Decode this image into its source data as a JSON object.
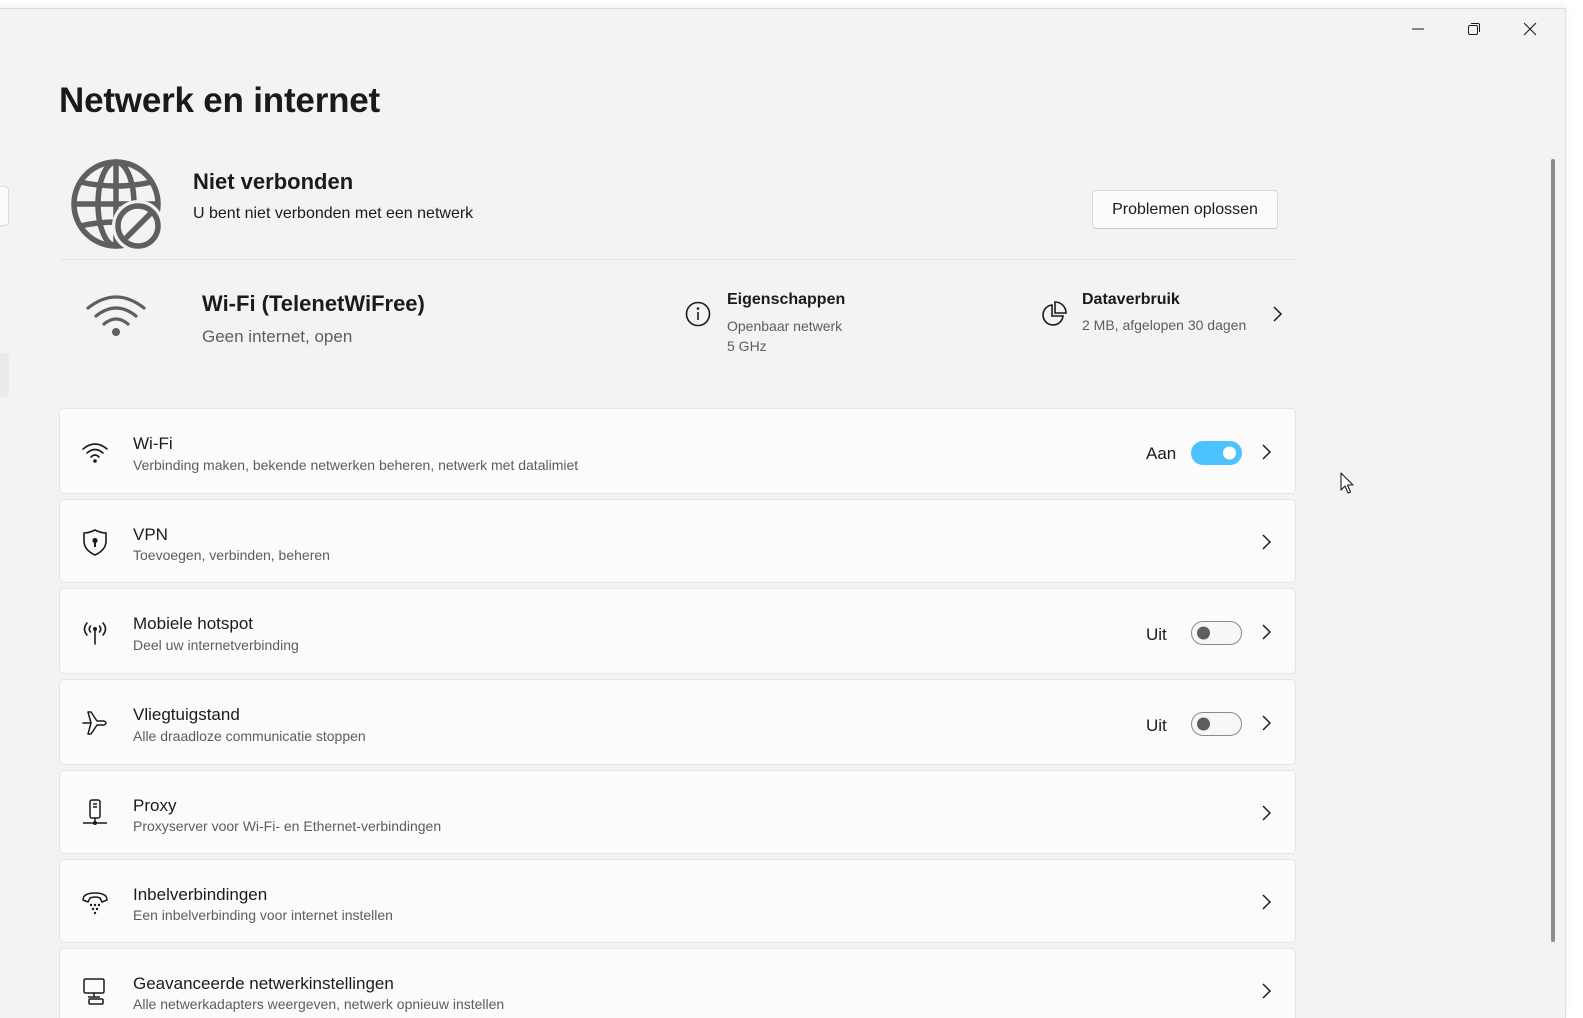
{
  "window": {
    "controls": [
      "minimize-icon",
      "restore-icon",
      "close-icon"
    ]
  },
  "page": {
    "title": "Netwerk en internet"
  },
  "status": {
    "icon": "globe-blocked-icon",
    "title": "Niet verbonden",
    "subtitle": "U bent niet verbonden met een netwerk",
    "troubleshoot_label": "Problemen oplossen"
  },
  "network": {
    "icon": "wifi-icon",
    "name": "Wi-Fi (TelenetWiFree)",
    "status": "Geen internet, open",
    "properties": {
      "icon": "info-icon",
      "title": "Eigenschappen",
      "line1": "Openbaar netwerk",
      "line2": "5 GHz"
    },
    "data_usage": {
      "icon": "pie-chart-icon",
      "title": "Dataverbruik",
      "subtitle": "2 MB, afgelopen 30 dagen"
    }
  },
  "settings": [
    {
      "key": "wifi",
      "icon": "wifi-icon",
      "title": "Wi-Fi",
      "subtitle": "Verbinding maken, bekende netwerken beheren, netwerk met datalimiet",
      "state": "Aan",
      "toggle": true
    },
    {
      "key": "vpn",
      "icon": "shield-icon",
      "title": "VPN",
      "subtitle": "Toevoegen, verbinden, beheren"
    },
    {
      "key": "hotspot",
      "icon": "hotspot-icon",
      "title": "Mobiele hotspot",
      "subtitle": "Deel uw internetverbinding",
      "state": "Uit",
      "toggle": false
    },
    {
      "key": "airplane",
      "icon": "airplane-icon",
      "title": "Vliegtuigstand",
      "subtitle": "Alle draadloze communicatie stoppen",
      "state": "Uit",
      "toggle": false
    },
    {
      "key": "proxy",
      "icon": "proxy-icon",
      "title": "Proxy",
      "subtitle": "Proxyserver voor Wi-Fi- en Ethernet-verbindingen"
    },
    {
      "key": "dialup",
      "icon": "dialup-icon",
      "title": "Inbelverbindingen",
      "subtitle": "Een inbelverbinding voor internet instellen"
    },
    {
      "key": "advanced",
      "icon": "advanced-network-icon",
      "title": "Geavanceerde netwerkinstellingen",
      "subtitle": "Alle netwerkadapters weergeven, netwerk opnieuw instellen"
    }
  ],
  "colors": {
    "accent": "#4cc2ff",
    "background": "#f3f3f3",
    "card": "#fbfbfb",
    "secondary_text": "#5d5d5d"
  }
}
